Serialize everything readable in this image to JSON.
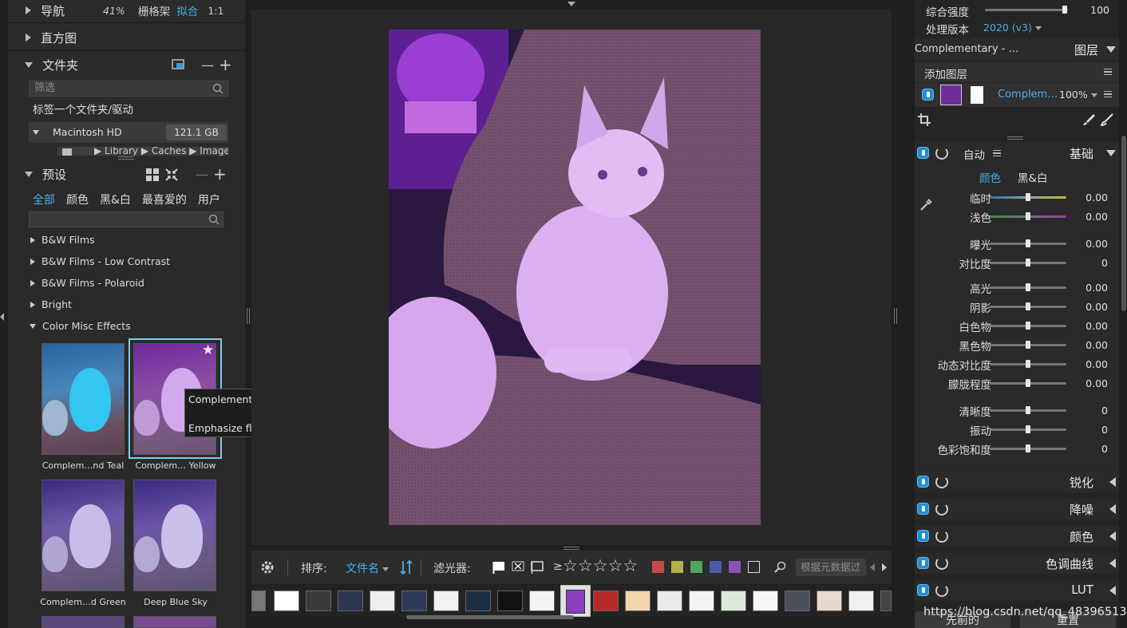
{
  "left": {
    "nav_label": "导航",
    "nav_zoom": "41%",
    "nav_grid": "栅格架",
    "nav_fit": "拟合",
    "nav_ratio": "1:1",
    "histogram_label": "直方图",
    "folders_label": "文件夹",
    "folders_minus": "—",
    "folders_plus": "+",
    "filter_placeholder": "筛选",
    "tag_folder": "标签一个文件夹/驱动",
    "drive_name": "Macintosh HD",
    "drive_size": "121.1 GB",
    "drive_path": "▶ Library ▶ Caches ▶ Images",
    "presets_label": "预设",
    "presets_minus": "—",
    "presets_plus": "+",
    "tabs": [
      "全部",
      "颜色",
      "黑&白",
      "最喜爱的",
      "用户"
    ],
    "preset_groups": [
      "B&W Films",
      "B&W Films - Low Contrast",
      "B&W Films - Polaroid",
      "Bright",
      "Color Misc Effects"
    ],
    "thumbs": [
      {
        "label": "Complem…nd Teal",
        "tint": "#1ca9d9"
      },
      {
        "label": "Complem… Yellow",
        "tint": "#a34fc4"
      },
      {
        "label": "Complem…d Green",
        "tint": "#6a59a8"
      },
      {
        "label": "Deep Blue Sky",
        "tint": "#6b55a9"
      }
    ],
    "tooltip_title": "Complementary - Purple and Yellow",
    "tooltip_desc": "Emphasize floral tones."
  },
  "bottom": {
    "sort_label": "排序:",
    "sort_value": "文件名",
    "filter_label": "滤光器:",
    "gte": "≥",
    "stars": "☆☆☆☆☆",
    "color_filters": [
      "#c04b4b",
      "#b5b04a",
      "#4ea85a",
      "#4b5aa8",
      "#8a55b5"
    ],
    "search_placeholder": "根据元数据过"
  },
  "right": {
    "strength_label": "综合强度",
    "strength_value": "100",
    "version_label": "处理版本",
    "version_value": "2020 (v3)",
    "layer_name": "Complementary - …",
    "layers_label": "图层",
    "add_layer": "添加图层",
    "layer_item_name": "Complem…",
    "layer_opacity": "100%",
    "basic_auto": "自动",
    "basic_title": "基础",
    "tab_color": "颜色",
    "tab_bw": "黑&白",
    "sliders": [
      {
        "label": "临时",
        "value": "0.00",
        "gradient": "temp"
      },
      {
        "label": "浅色",
        "value": "0.00",
        "gradient": "tint"
      },
      {
        "label": "曝光",
        "value": "0.00"
      },
      {
        "label": "对比度",
        "value": "0"
      },
      {
        "label": "高光",
        "value": "0.00"
      },
      {
        "label": "阴影",
        "value": "0.00"
      },
      {
        "label": "白色物",
        "value": "0.00"
      },
      {
        "label": "黑色物",
        "value": "0.00"
      },
      {
        "label": "动态对比度",
        "value": "0.00"
      },
      {
        "label": "朦胧程度",
        "value": "0.00"
      },
      {
        "label": "清晰度",
        "value": "0"
      },
      {
        "label": "振动",
        "value": "0"
      },
      {
        "label": "色彩饱和度",
        "value": "0"
      }
    ],
    "sections": [
      "锐化",
      "降噪",
      "颜色",
      "色调曲线",
      "LUT"
    ],
    "btn_prev": "先前的",
    "btn_reset": "重置"
  },
  "watermark": "https://blog.csdn.net/qq_48396513"
}
